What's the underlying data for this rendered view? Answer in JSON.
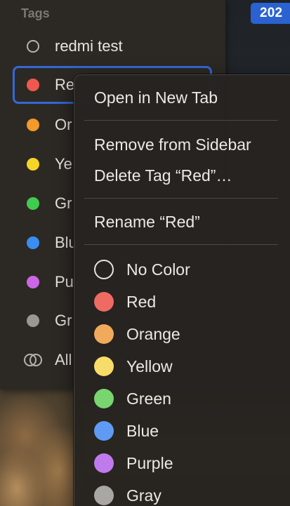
{
  "top_badge": "202",
  "sidebar": {
    "title": "Tags",
    "items": [
      {
        "label": "redmi test",
        "color": "none"
      },
      {
        "label": "Re",
        "color": "#f0584f"
      },
      {
        "label": "Or",
        "color": "#f29a2a"
      },
      {
        "label": "Ye",
        "color": "#f5d327"
      },
      {
        "label": "Gr",
        "color": "#3fcc4f"
      },
      {
        "label": "Blu",
        "color": "#3a8df3"
      },
      {
        "label": "Pu",
        "color": "#cc66e6"
      },
      {
        "label": "Gr",
        "color": "#9a9894"
      },
      {
        "label": "All",
        "color": "all"
      }
    ]
  },
  "context_menu": {
    "open_new_tab": "Open in New Tab",
    "remove_from_sidebar": "Remove from Sidebar",
    "delete_tag": "Delete Tag “Red”…",
    "rename": "Rename “Red”",
    "colors": [
      {
        "label": "No Color",
        "color": "none"
      },
      {
        "label": "Red",
        "color": "#ee6b63"
      },
      {
        "label": "Orange",
        "color": "#f1a95c"
      },
      {
        "label": "Yellow",
        "color": "#f8dc6a"
      },
      {
        "label": "Green",
        "color": "#79d56f"
      },
      {
        "label": "Blue",
        "color": "#5f9bf5"
      },
      {
        "label": "Purple",
        "color": "#bf7aec"
      },
      {
        "label": "Gray",
        "color": "#a9a7a4"
      }
    ]
  }
}
